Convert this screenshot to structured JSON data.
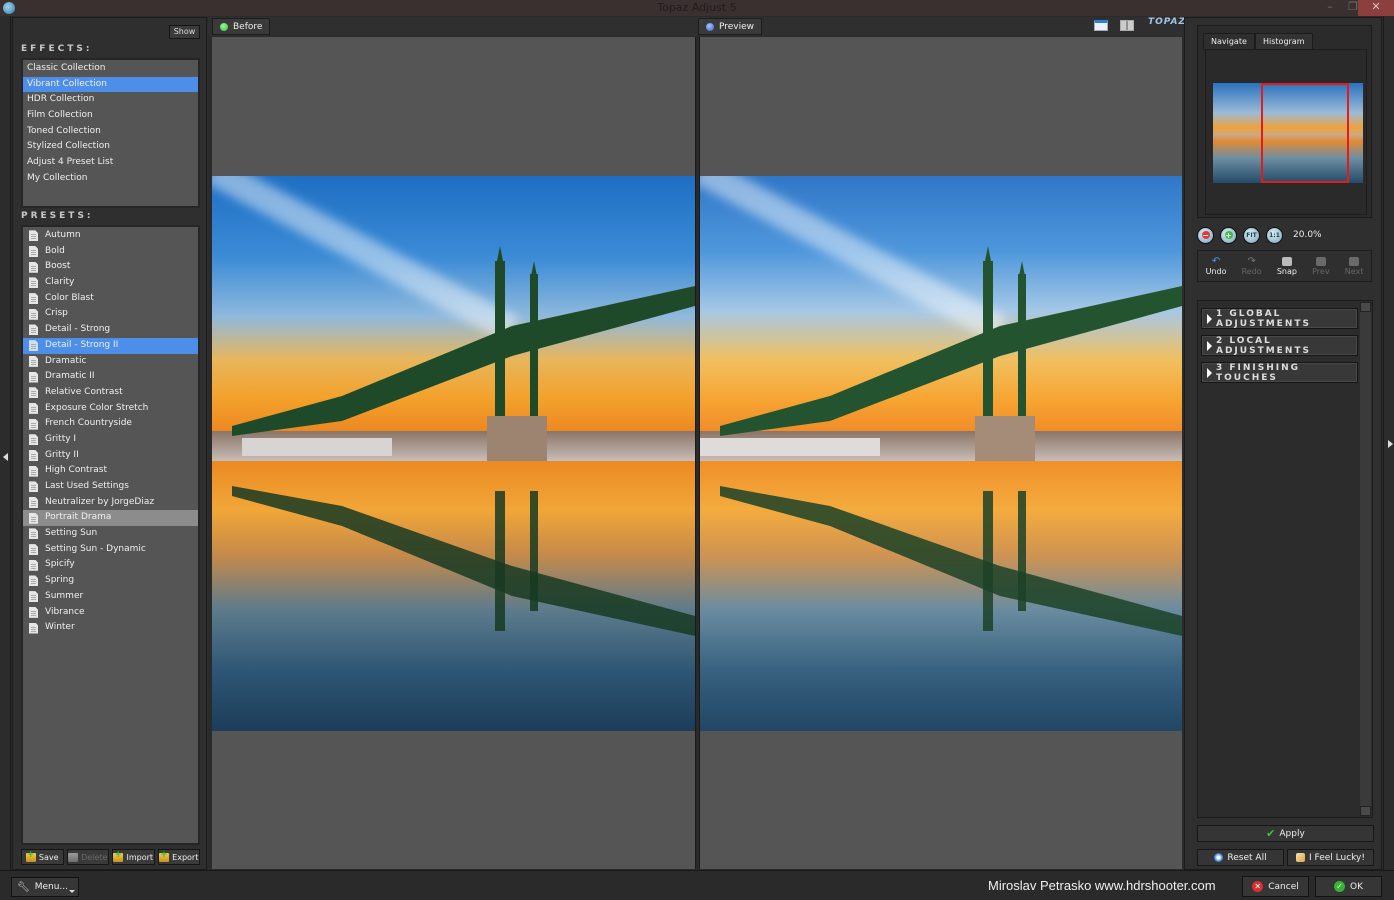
{
  "window": {
    "title": "Topaz Adjust 5",
    "controls": {
      "minimize": "–",
      "maximize": "❐",
      "close": "✕"
    }
  },
  "left_panel": {
    "show_label": "Show",
    "effects_label": "EFFECTS:",
    "effects": [
      {
        "label": "Classic Collection",
        "selected": false
      },
      {
        "label": "Vibrant Collection",
        "selected": true
      },
      {
        "label": "HDR Collection",
        "selected": false
      },
      {
        "label": "Film Collection",
        "selected": false
      },
      {
        "label": "Toned Collection",
        "selected": false
      },
      {
        "label": "Stylized Collection",
        "selected": false
      },
      {
        "label": "Adjust 4 Preset List",
        "selected": false
      },
      {
        "label": "My Collection",
        "selected": false
      }
    ],
    "presets_label": "PRESETS:",
    "presets": [
      {
        "label": "Autumn",
        "state": ""
      },
      {
        "label": "Bold",
        "state": ""
      },
      {
        "label": "Boost",
        "state": ""
      },
      {
        "label": "Clarity",
        "state": ""
      },
      {
        "label": "Color Blast",
        "state": ""
      },
      {
        "label": "Crisp",
        "state": ""
      },
      {
        "label": "Detail - Strong",
        "state": ""
      },
      {
        "label": "Detail - Strong II",
        "state": "selected"
      },
      {
        "label": "Dramatic",
        "state": ""
      },
      {
        "label": "Dramatic II",
        "state": ""
      },
      {
        "label": "Relative Contrast",
        "state": ""
      },
      {
        "label": "Exposure Color Stretch",
        "state": ""
      },
      {
        "label": "French Countryside",
        "state": ""
      },
      {
        "label": "Gritty I",
        "state": ""
      },
      {
        "label": "Gritty II",
        "state": ""
      },
      {
        "label": "High Contrast",
        "state": ""
      },
      {
        "label": "Last Used Settings",
        "state": ""
      },
      {
        "label": "Neutralizer by JorgeDiaz",
        "state": ""
      },
      {
        "label": "Portrait Drama",
        "state": "hover"
      },
      {
        "label": "Setting Sun",
        "state": ""
      },
      {
        "label": "Setting Sun - Dynamic",
        "state": ""
      },
      {
        "label": "Spicify",
        "state": ""
      },
      {
        "label": "Spring",
        "state": ""
      },
      {
        "label": "Summer",
        "state": ""
      },
      {
        "label": "Vibrance",
        "state": ""
      },
      {
        "label": "Winter",
        "state": ""
      }
    ],
    "buttons": {
      "save": "Save",
      "delete": "Delete",
      "import": "Import",
      "export": "Export"
    }
  },
  "view": {
    "before_label": "Before",
    "preview_label": "Preview",
    "before_dot_color": "#3fd23f",
    "preview_dot_color": "#3a6ee0",
    "logo_text": "TOPAZ"
  },
  "right_panel": {
    "tabs": {
      "navigate": "Navigate",
      "histogram": "Histogram"
    },
    "zoom_buttons": {
      "zoom_out": "−",
      "zoom_in": "+",
      "fit": "FIT",
      "one_to_one": "1:1"
    },
    "zoom_level": "20.0%",
    "history": {
      "undo": "Undo",
      "redo": "Redo",
      "snap": "Snap",
      "prev": "Prev",
      "next": "Next"
    },
    "adjustments": [
      "1 GLOBAL ADJUSTMENTS",
      "2 LOCAL ADJUSTMENTS",
      "3 FINISHING TOUCHES"
    ],
    "apply": "Apply",
    "reset_all": "Reset All",
    "feel_lucky": "I Feel Lucky!"
  },
  "status_bar": {
    "menu": "Menu...",
    "credit": "Miroslav  Petrasko  www.hdrshooter.com",
    "cancel": "Cancel",
    "ok": "OK"
  },
  "colors": {
    "selection": "#4d8ee8",
    "hover_row": "#8c8c8c",
    "navigator_frame": "#e21c1c",
    "close_button": "#8c3f3f"
  }
}
